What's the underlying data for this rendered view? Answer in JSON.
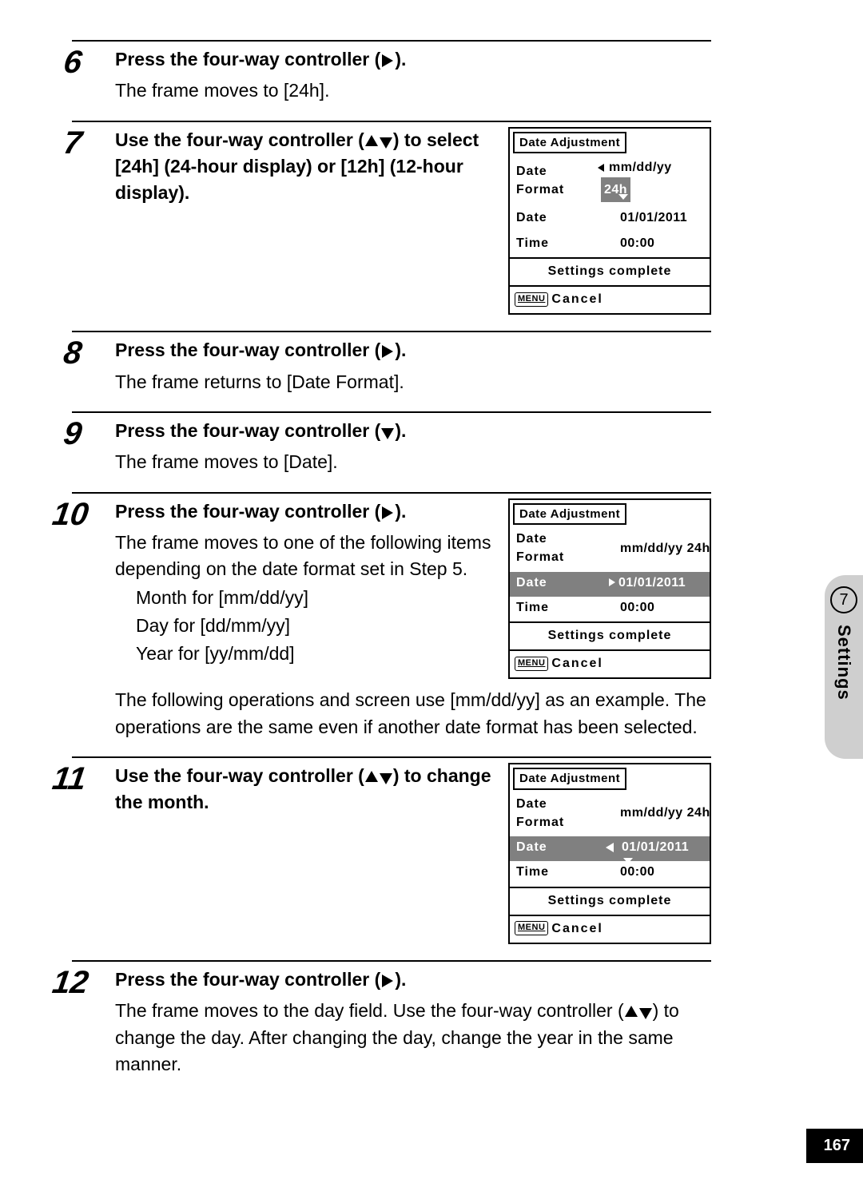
{
  "sidebar": {
    "chapter": "7",
    "label": "Settings"
  },
  "pageNumber": "167",
  "lcd": {
    "title": "Date Adjustment",
    "labels": {
      "format": "Date Format",
      "date": "Date",
      "time": "Time"
    },
    "values": {
      "format": "mm/dd/yy",
      "hours": "24h",
      "date": "01/01/2011",
      "time": "00:00"
    },
    "complete": "Settings complete",
    "menu": "MENU",
    "cancel": "Cancel"
  },
  "steps": {
    "s6": {
      "num": "6",
      "title_a": "Press the four-way controller (",
      "title_b": ").",
      "desc": "The frame moves to [24h]."
    },
    "s7": {
      "num": "7",
      "title_a": "Use the four-way controller (",
      "title_b": ") to select [24h] (24-hour display) or [12h] (12-hour display)."
    },
    "s8": {
      "num": "8",
      "title_a": "Press the four-way controller (",
      "title_b": ").",
      "desc": "The frame returns to [Date Format]."
    },
    "s9": {
      "num": "9",
      "title_a": "Press the four-way controller (",
      "title_b": ").",
      "desc": "The frame moves to [Date]."
    },
    "s10": {
      "num": "10",
      "title_a": "Press the four-way controller (",
      "title_b": ").",
      "desc": "The frame moves to one of the following items depending on the date format set in Step 5.",
      "sub1": "Month for [mm/dd/yy]",
      "sub2": "Day for [dd/mm/yy]",
      "sub3": "Year for [yy/mm/dd]",
      "note": "The following operations and screen use [mm/dd/yy] as an example. The operations are the same even if another date format has been selected."
    },
    "s11": {
      "num": "11",
      "title_a": "Use the four-way controller (",
      "title_b": ") to change the month."
    },
    "s12": {
      "num": "12",
      "title_a": "Press the four-way controller (",
      "title_b": ").",
      "desc_a": "The frame moves to the day field. Use the four-way controller (",
      "desc_b": ") to change the day. After changing the day, change the year in the same manner."
    }
  }
}
